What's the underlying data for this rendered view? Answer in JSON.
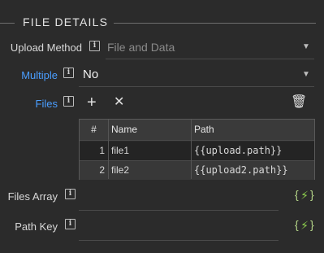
{
  "section": {
    "title": "FILE DETAILS"
  },
  "fields": {
    "upload_method": {
      "label": "Upload Method",
      "value": "File and Data"
    },
    "multiple": {
      "label": "Multiple",
      "value": "No"
    },
    "files": {
      "label": "Files"
    },
    "files_array": {
      "label": "Files Array"
    },
    "path_key": {
      "label": "Path Key"
    }
  },
  "table": {
    "headers": [
      "#",
      "Name",
      "Path"
    ],
    "rows": [
      {
        "index": "1",
        "name": "file1",
        "path": "{{upload.path}}"
      },
      {
        "index": "2",
        "name": "file2",
        "path": "{{upload2.path}}"
      }
    ]
  },
  "glyphs": {
    "info": "i",
    "caret": "▼",
    "add": "+",
    "remove": "✕",
    "trash": "🗑",
    "bolt": "⚡",
    "brace_open": "{",
    "brace_close": "}"
  },
  "colors": {
    "background": "#2b2b2b",
    "accent_blue": "#4a9eff",
    "bolt_green": "#8fd14f"
  }
}
